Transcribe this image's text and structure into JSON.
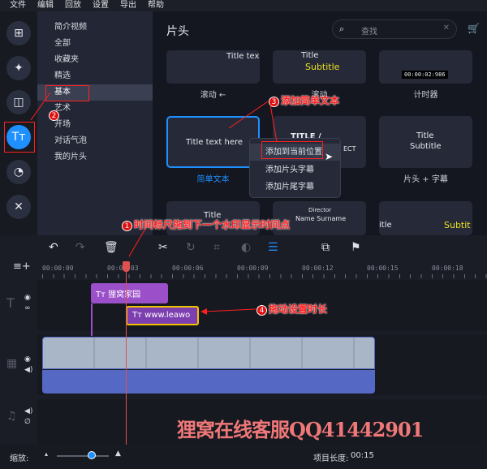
{
  "menu": [
    "文件",
    "编辑",
    "回放",
    "设置",
    "导出",
    "帮助"
  ],
  "rail": [
    {
      "icon": "import-icon",
      "glyph": "⊞"
    },
    {
      "icon": "magic-wand-icon",
      "glyph": "✦"
    },
    {
      "icon": "transitions-icon",
      "glyph": "◫"
    },
    {
      "icon": "titles-icon",
      "glyph": "Tт"
    },
    {
      "icon": "sticker-icon",
      "glyph": "◔"
    },
    {
      "icon": "tools-icon",
      "glyph": "✕"
    }
  ],
  "categories": [
    "简介视频",
    "全部",
    "收藏夹",
    "精选",
    "基本",
    "艺术",
    "开场",
    "对话气泡",
    "我的片头"
  ],
  "selected_category": "基本",
  "main": {
    "title": "片头",
    "search_placeholder": "查找",
    "cards": [
      {
        "preview": "Title tex",
        "label": "滚动 ←"
      },
      {
        "preview": "Title",
        "preview2": "Subtitle",
        "label": "滚动"
      },
      {
        "preview": "00:00:02:986",
        "label": "计时器"
      },
      {
        "preview": "Title text here",
        "label": "简单文本"
      },
      {
        "preview": "TITLE /",
        "preview2": "ECT",
        "label": ""
      },
      {
        "preview": "Title",
        "preview2": "Subtitle",
        "label": "片头 + 字幕"
      },
      {
        "preview": "Title",
        "label": ""
      },
      {
        "preview": "Director",
        "preview2": "Name Surname",
        "label": ""
      },
      {
        "preview": "itle",
        "preview2": "Subtit",
        "label": ""
      }
    ]
  },
  "context_menu": [
    "添加到当前位置",
    "添加片头字幕",
    "添加片尾字幕"
  ],
  "annotations": {
    "a1": "时间标尺拖到下一个水印显示时间点",
    "a2": "",
    "a3": "添加简单文本",
    "a4": "拖动设置时长",
    "n1": "1",
    "n2": "2",
    "n3": "3",
    "n4": "4"
  },
  "timeline": {
    "ruler": [
      "00:00:00",
      "00:00:03",
      "00:00:06",
      "00:00:09",
      "00:00:12",
      "00:00:15",
      "00:00:18"
    ],
    "clips": [
      {
        "label": "狸窝家园"
      },
      {
        "label": "www.leawo"
      }
    ]
  },
  "watermark": "狸窝在线客服QQ41442901",
  "bottom": {
    "zoom_label": "缩放:",
    "zoom_level": 0.75,
    "duration_label": "项目长度:",
    "duration": "00:15"
  },
  "colors": {
    "accent": "#1e90ff",
    "clip": "#9b4fc9",
    "video": "#5468c4",
    "annotation": "#ff2020"
  }
}
